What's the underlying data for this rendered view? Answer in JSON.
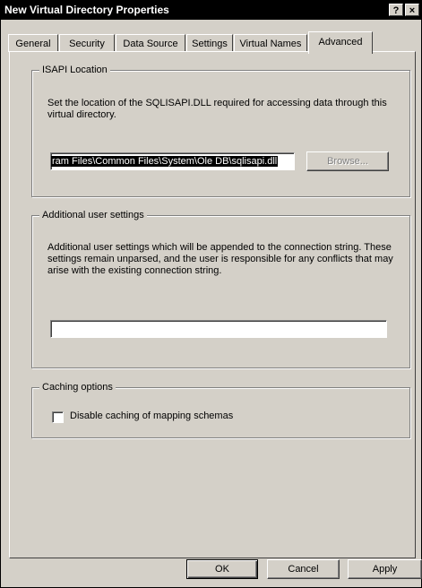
{
  "window": {
    "title": "New Virtual Directory Properties",
    "help_label": "?",
    "close_label": "×"
  },
  "tabs": [
    {
      "label": "General"
    },
    {
      "label": "Security"
    },
    {
      "label": "Data Source"
    },
    {
      "label": "Settings"
    },
    {
      "label": "Virtual Names"
    },
    {
      "label": "Advanced"
    }
  ],
  "active_tab": "Advanced",
  "isapi": {
    "legend": "ISAPI Location",
    "description": "Set the location of the SQLISAPI.DLL required for accessing data through this virtual directory.",
    "path_value": "ram Files\\Common Files\\System\\Ole DB\\sqlisapi.dll",
    "browse_label": "Browse..."
  },
  "additional": {
    "legend": "Additional user settings",
    "description": "Additional user settings which will be appended to the connection string. These settings remain unparsed, and the user is responsible for any conflicts that may arise with the existing connection string.",
    "value": ""
  },
  "caching": {
    "legend": "Caching options",
    "checkbox_label": "Disable caching of mapping schemas",
    "checked": false
  },
  "footer": {
    "ok_label": "OK",
    "cancel_label": "Cancel",
    "apply_label": "Apply"
  }
}
